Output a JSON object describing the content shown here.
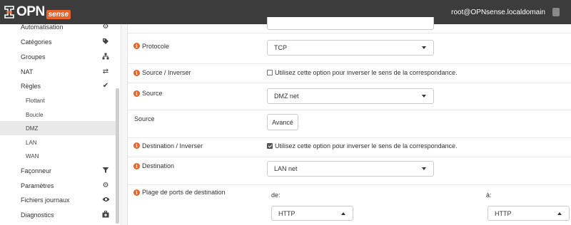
{
  "header": {
    "brand_main": "OPN",
    "brand_sub": "sense",
    "user": "root@OPNsense.localdomain"
  },
  "sidebar": {
    "items": [
      {
        "label": "Automatisation",
        "icon": "gear-icon",
        "glyph": "⚙"
      },
      {
        "label": "Catégories",
        "icon": "tags-icon",
        "glyph": "🏷"
      },
      {
        "label": "Groupes",
        "icon": "sitemap-icon",
        "glyph": "⊹"
      },
      {
        "label": "NAT",
        "icon": "exchange-icon",
        "glyph": "⇄"
      },
      {
        "label": "Règles",
        "icon": "check-icon",
        "glyph": "✔"
      },
      {
        "label": "Flottant"
      },
      {
        "label": "Boucle"
      },
      {
        "label": "DMZ",
        "active": true
      },
      {
        "label": "LAN"
      },
      {
        "label": "WAN"
      },
      {
        "label": "Façonneur",
        "icon": "filter-icon",
        "glyph": "▼"
      },
      {
        "label": "Paramètres",
        "icon": "cogs-icon",
        "glyph": "⚙"
      },
      {
        "label": "Fichiers journaux",
        "icon": "eye-icon",
        "glyph": "👁"
      },
      {
        "label": "Diagnostics",
        "icon": "medkit-icon",
        "glyph": "▣"
      }
    ]
  },
  "form": {
    "protocol_label": "Protocole",
    "protocol_value": "TCP",
    "source_invert_label": "Source / Inverser",
    "source_invert_text": "Utilisez cette option pour inverser le sens de la correspondance.",
    "source_invert_checked": false,
    "source_label": "Source",
    "source_value": "DMZ net",
    "source_adv_label": "Source",
    "advanced_button": "Avancé",
    "dest_invert_label": "Destination / Inverser",
    "dest_invert_text": "Utilisez cette option pour inverser le sens de la correspondance.",
    "dest_invert_checked": true,
    "destination_label": "Destination",
    "destination_value": "LAN net",
    "port_range_label": "Plage de ports de destination",
    "from_label": "de:",
    "to_label": "à:",
    "from_value": "HTTP",
    "to_value": "HTTP"
  },
  "colors": {
    "accent": "#e8632a",
    "header_bg": "#3c3c3c"
  }
}
